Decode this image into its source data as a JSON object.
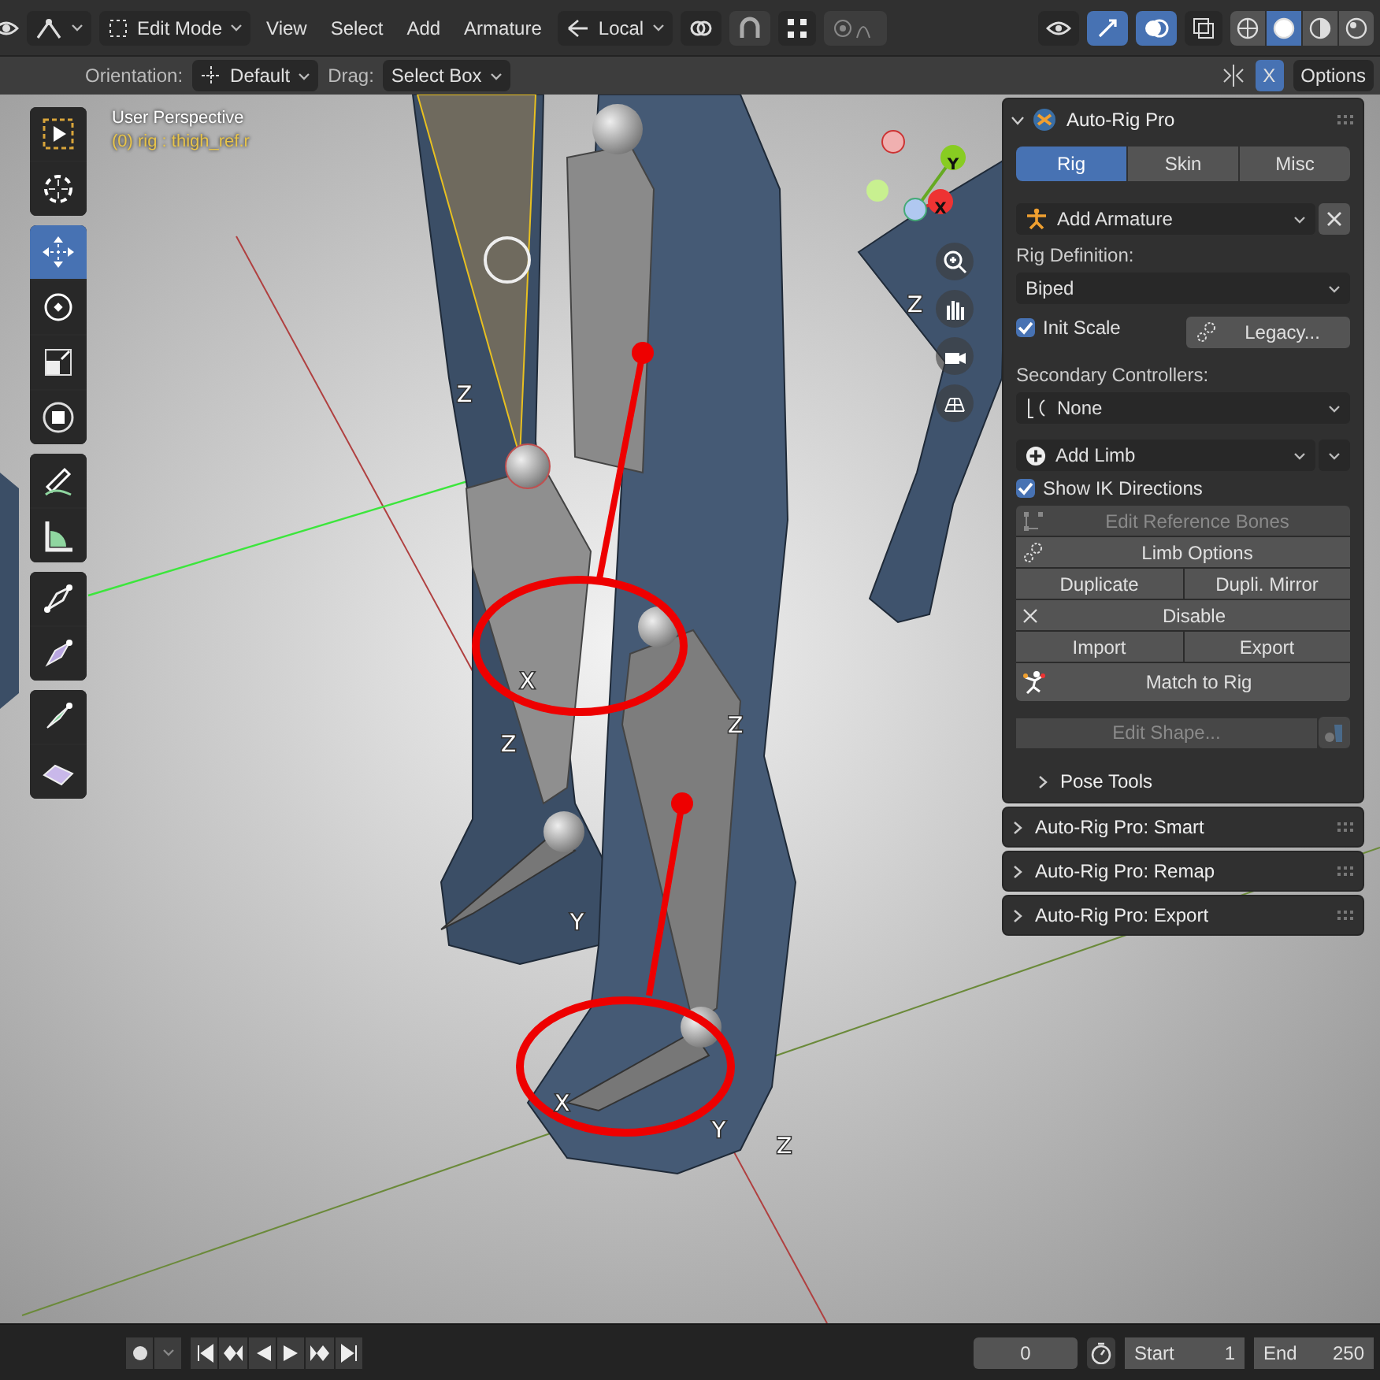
{
  "header": {
    "mode": "Edit Mode",
    "menus": [
      "View",
      "Select",
      "Add",
      "Armature"
    ],
    "orientation": "Local",
    "toggles": [
      {
        "kind": "gizmo",
        "on": true
      },
      {
        "kind": "overlay",
        "on": true
      }
    ],
    "shading": [
      {
        "kind": "wire",
        "selected": false
      },
      {
        "kind": "solid",
        "selected": true
      },
      {
        "kind": "material",
        "selected": false
      },
      {
        "kind": "render",
        "selected": false
      }
    ]
  },
  "tool_settings": {
    "orientation_label": "Orientation:",
    "orientation": "Default",
    "drag_label": "Drag:",
    "drag": "Select Box",
    "mirror_x": {
      "label": "X",
      "on": true
    },
    "options": "Options"
  },
  "viewport": {
    "title": "User Perspective",
    "object": "(0) rig : thigh_ref.r",
    "axis_labels": [
      "Z",
      "X",
      "Z",
      "Z",
      "Y",
      "X",
      "Y",
      "Z",
      "Z"
    ],
    "gizmo_labels": [
      "Y",
      "X"
    ]
  },
  "toolbar": {
    "groups": [
      {
        "tools": [
          {
            "kind": "select_box",
            "selected": false
          },
          {
            "kind": "cursor",
            "selected": false
          }
        ]
      },
      {
        "tools": [
          {
            "kind": "move",
            "selected": true
          },
          {
            "kind": "rotate",
            "selected": false
          },
          {
            "kind": "scale",
            "selected": false
          },
          {
            "kind": "transform",
            "selected": false
          }
        ]
      },
      {
        "tools": [
          {
            "kind": "annotate",
            "selected": false
          },
          {
            "kind": "measure",
            "selected": false
          }
        ]
      },
      {
        "tools": [
          {
            "kind": "roll",
            "selected": false
          },
          {
            "kind": "bone_size",
            "selected": false
          }
        ]
      },
      {
        "tools": [
          {
            "kind": "extrude",
            "selected": false
          },
          {
            "kind": "box",
            "selected": false
          }
        ]
      }
    ]
  },
  "panel": {
    "title": "Auto-Rig Pro",
    "expanded": true,
    "tabs": [
      {
        "label": "Rig",
        "selected": true
      },
      {
        "label": "Skin",
        "selected": false
      },
      {
        "label": "Misc",
        "selected": false
      }
    ],
    "armature_dropdown": "Add Armature",
    "rig_definition_label": "Rig Definition:",
    "rig_definition": "Biped",
    "init_scale": {
      "label": "Init Scale",
      "checked": true
    },
    "legacy_button": "Legacy...",
    "secondary_label": "Secondary Controllers:",
    "secondary": "None",
    "limb_dropdown": "Add Limb",
    "show_ik": {
      "label": "Show IK Directions",
      "checked": true
    },
    "button_rows": [
      [
        {
          "label": "Edit Reference Bones",
          "kind": "bones",
          "disabled": true
        }
      ],
      [
        {
          "label": "Limb Options",
          "kind": "gears",
          "disabled": false
        }
      ],
      [
        {
          "label": "Duplicate",
          "kind": "plain",
          "disabled": false
        },
        {
          "label": "Dupli. Mirror",
          "kind": "plain",
          "disabled": false
        }
      ],
      [
        {
          "label": "Disable",
          "kind": "x",
          "disabled": false
        }
      ],
      [
        {
          "label": "Import",
          "kind": "plain",
          "disabled": false
        },
        {
          "label": "Export",
          "kind": "plain",
          "disabled": false
        }
      ],
      [
        {
          "label": "Match to Rig",
          "kind": "figure",
          "disabled": false
        }
      ]
    ],
    "edit_shape": {
      "label": "Edit Shape...",
      "disabled": true
    },
    "subpanel": {
      "label": "Pose Tools",
      "expanded": false
    }
  },
  "collapsed_panels": [
    {
      "title": "Auto-Rig Pro: Smart",
      "expanded": false
    },
    {
      "title": "Auto-Rig Pro: Remap",
      "expanded": false
    },
    {
      "title": "Auto-Rig Pro: Export",
      "expanded": false
    }
  ],
  "timeline": {
    "frame": "0",
    "start_label": "Start",
    "start": "1",
    "end_label": "End",
    "end": "250"
  }
}
